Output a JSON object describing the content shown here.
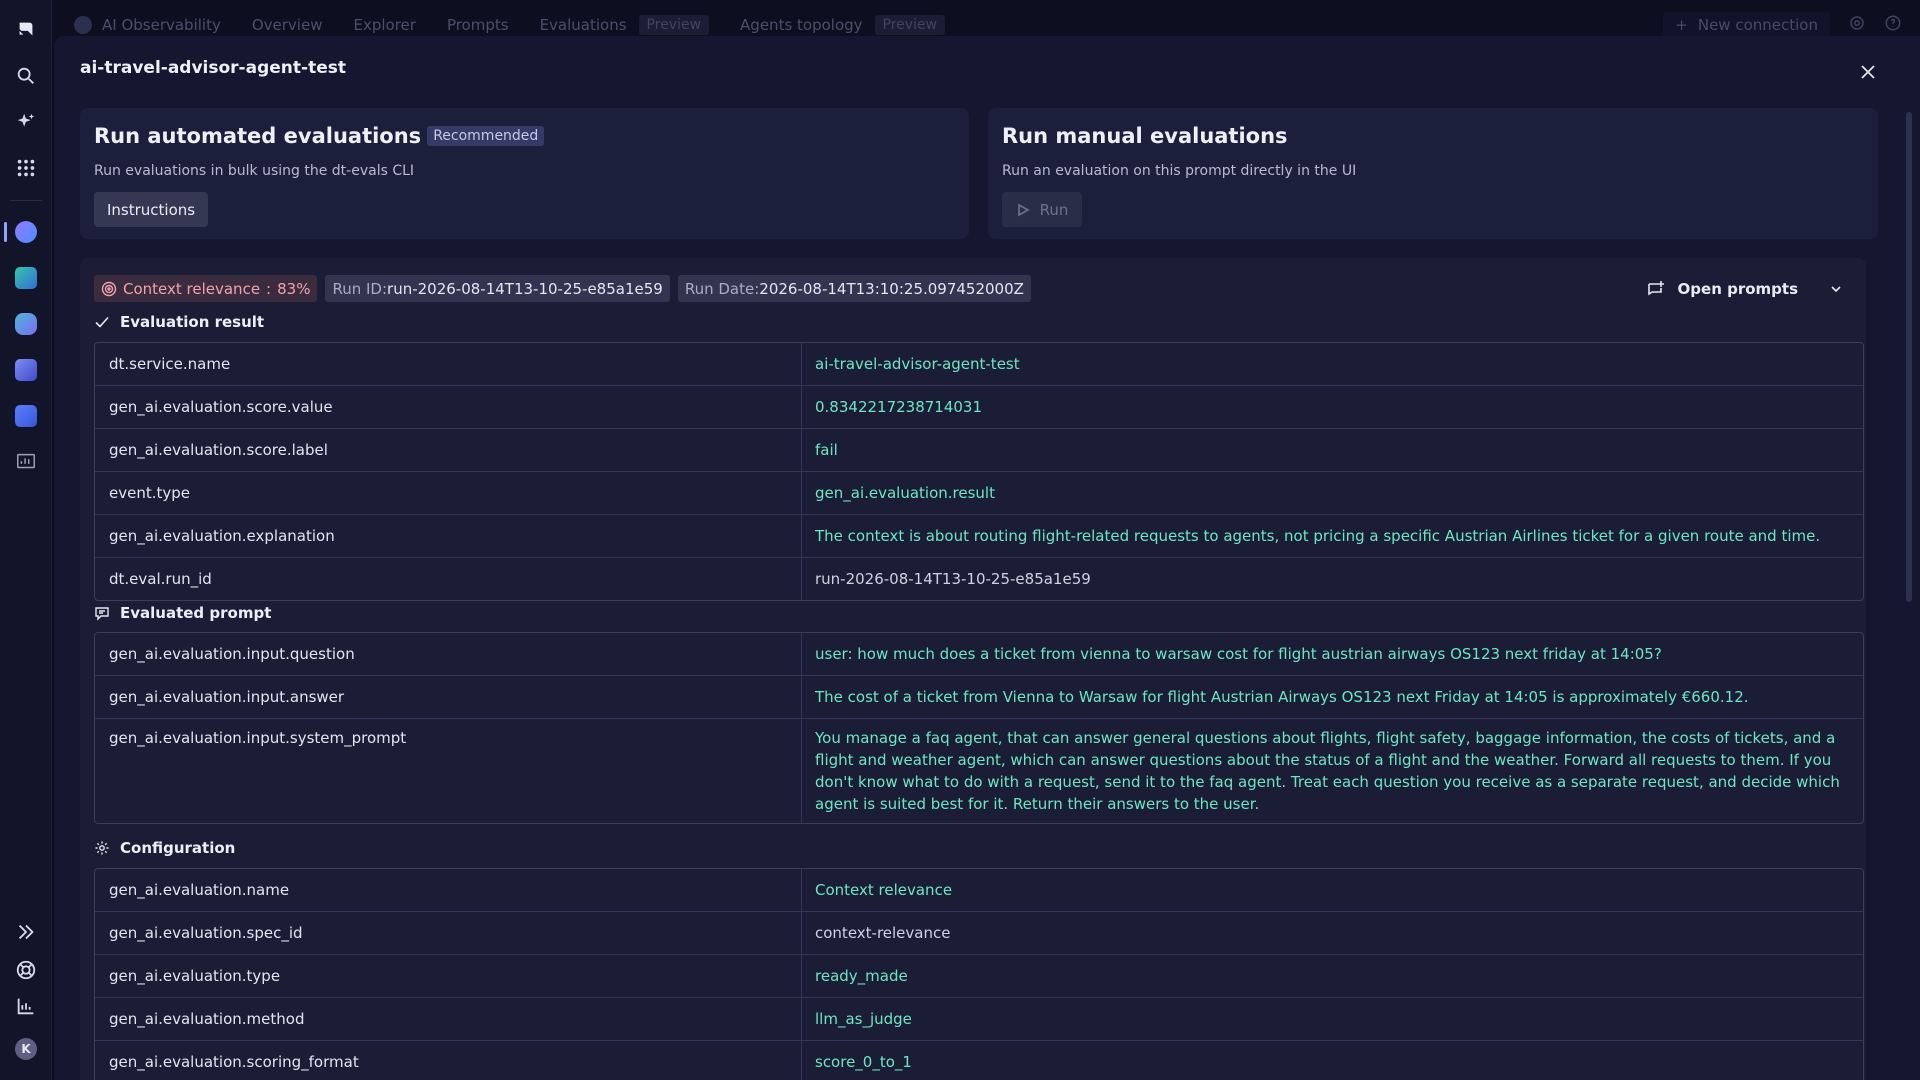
{
  "topbar": {
    "app_name": "AI Observability",
    "tabs": [
      {
        "label": "Overview"
      },
      {
        "label": "Explorer"
      },
      {
        "label": "Prompts"
      },
      {
        "label": "Evaluations",
        "tag": "Preview"
      },
      {
        "label": "Agents topology",
        "tag": "Preview"
      }
    ],
    "new_connection": "New connection"
  },
  "modal": {
    "title": "ai-travel-advisor-agent-test"
  },
  "automated": {
    "title": "Run automated evaluations",
    "badge": "Recommended",
    "subtitle": "Run evaluations in bulk using the dt-evals CLI",
    "button": "Instructions"
  },
  "manual": {
    "title": "Run manual evaluations",
    "subtitle": "Run an evaluation on this prompt directly in the UI",
    "button": "Run"
  },
  "chips": {
    "context_label": "Context relevance",
    "context_value": "83%",
    "run_id_label": "Run ID",
    "run_id_value": "run-2026-08-14T13-10-25-e85a1e59",
    "run_date_label": "Run Date",
    "run_date_value": "2026-08-14T13:10:25.097452000Z"
  },
  "open_prompts": "Open prompts",
  "sections": {
    "evaluation_result": {
      "title": "Evaluation result",
      "rows": [
        {
          "key": "dt.service.name",
          "value": "ai-travel-advisor-agent-test"
        },
        {
          "key": "gen_ai.evaluation.score.value",
          "value": "0.8342217238714031"
        },
        {
          "key": "gen_ai.evaluation.score.label",
          "value": "fail"
        },
        {
          "key": "event.type",
          "value": "gen_ai.evaluation.result"
        },
        {
          "key": "gen_ai.evaluation.explanation",
          "value": "The context is about routing flight-related requests to agents, not pricing a specific Austrian Airlines ticket for a given route and time."
        },
        {
          "key": "dt.eval.run_id",
          "value": "run-2026-08-14T13-10-25-e85a1e59"
        }
      ]
    },
    "evaluated_prompt": {
      "title": "Evaluated prompt",
      "rows": [
        {
          "key": "gen_ai.evaluation.input.question",
          "value": "user: how much does a ticket from vienna to warsaw cost for flight austrian airways OS123 next friday at 14:05?"
        },
        {
          "key": "gen_ai.evaluation.input.answer",
          "value": "The cost of a ticket from Vienna to Warsaw for flight Austrian Airways OS123 next Friday at 14:05 is approximately €660.12."
        },
        {
          "key": "gen_ai.evaluation.input.system_prompt",
          "value": "You manage a faq agent, that can answer general questions about flights, flight safety, baggage information, the costs of tickets, and a flight and weather agent, which can answer questions about the status of a flight and the weather. Forward all requests to them. If you don't know what to do with a request, send it to the faq agent. Treat each question you receive as a separate request, and decide which agent is suited best for it. Return their answers to the user."
        }
      ]
    },
    "configuration": {
      "title": "Configuration",
      "rows": [
        {
          "key": "gen_ai.evaluation.name",
          "value": "Context relevance"
        },
        {
          "key": "gen_ai.evaluation.spec_id",
          "value": "context-relevance"
        },
        {
          "key": "gen_ai.evaluation.type",
          "value": "ready_made"
        },
        {
          "key": "gen_ai.evaluation.method",
          "value": "llm_as_judge"
        },
        {
          "key": "gen_ai.evaluation.scoring_format",
          "value": "score_0_to_1"
        }
      ]
    }
  },
  "colors": {
    "value_accent": "#6ee6c4",
    "fail_chip": "#f0a3ad",
    "rail_active": "#9aa0ff"
  }
}
